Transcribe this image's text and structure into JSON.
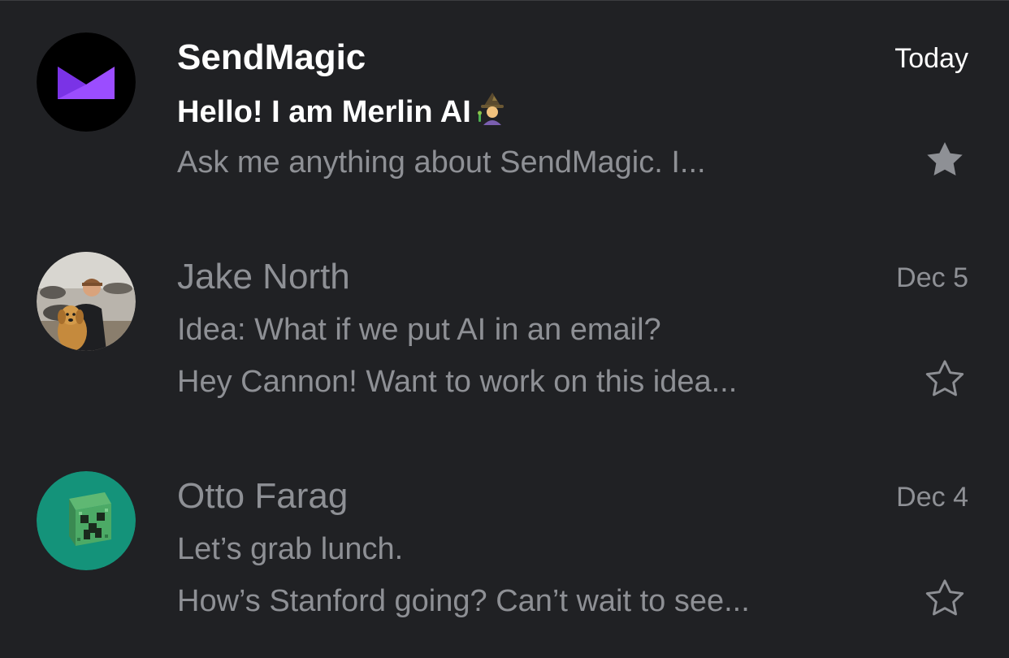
{
  "inbox": {
    "messages": [
      {
        "sender": "SendMagic",
        "subject": "Hello! I am Merlin AI",
        "subject_emoji": "mage-emoji",
        "preview": "Ask me anything about SendMagic. I...",
        "date": "Today",
        "unread": true,
        "starred": true,
        "avatar_icon": "sendmagic-logo-icon",
        "avatar_bg": "#000000",
        "avatar_accent": "#9b4dff"
      },
      {
        "sender": "Jake North",
        "subject": "Idea: What if we put AI in an email?",
        "preview": "Hey Cannon! Want to work on this idea...",
        "date": "Dec 5",
        "unread": false,
        "starred": false,
        "avatar_icon": "profile-photo-icon"
      },
      {
        "sender": "Otto Farag",
        "subject": "Let’s grab lunch.",
        "preview": "How’s Stanford going? Can’t wait to see...",
        "date": "Dec 4",
        "unread": false,
        "starred": false,
        "avatar_icon": "creeper-block-icon",
        "avatar_bg": "#14937a"
      }
    ]
  },
  "colors": {
    "background": "#202124",
    "text_unread": "#ffffff",
    "text_muted": "#8e9095",
    "star_filled": "#8e9095"
  }
}
